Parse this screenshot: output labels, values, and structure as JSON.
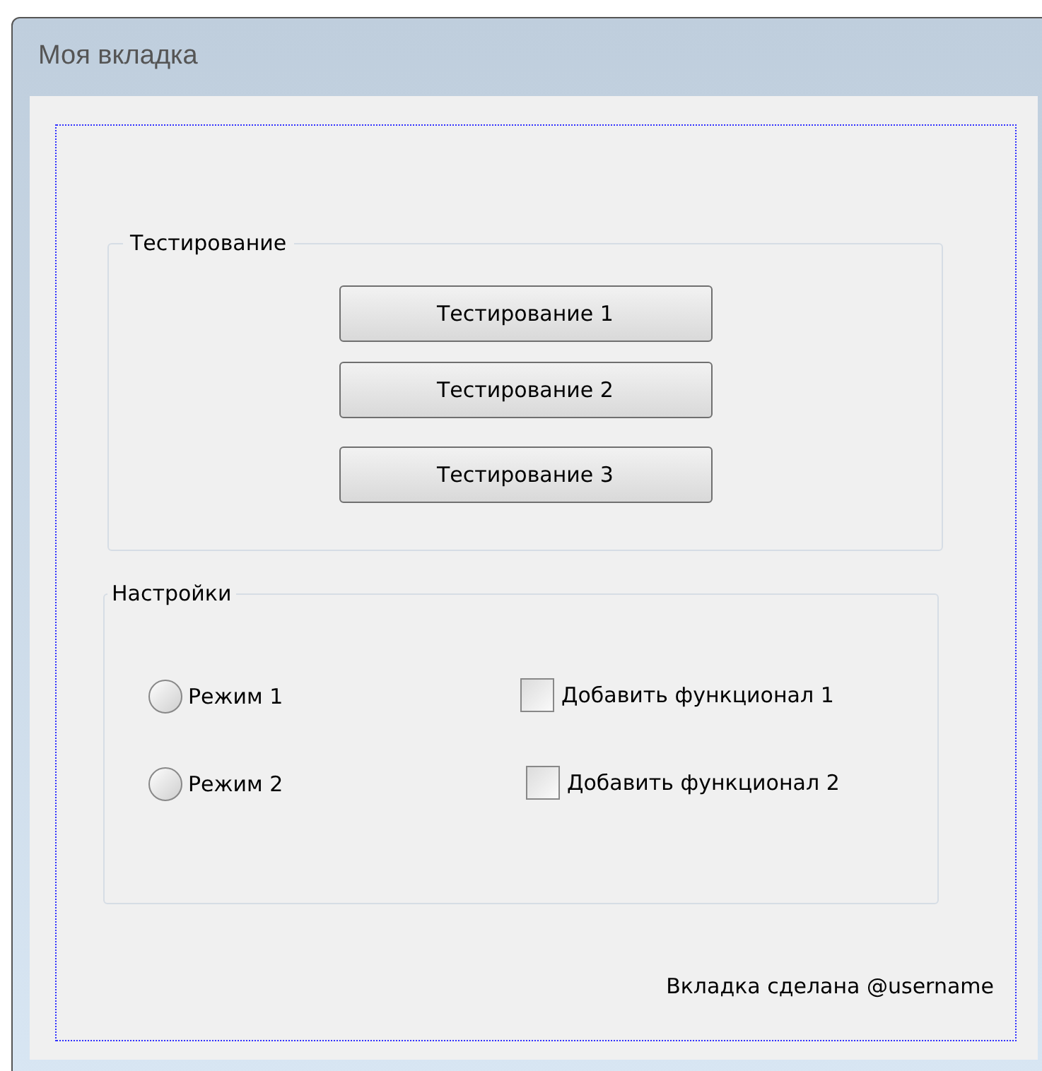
{
  "window": {
    "title": "Моя вкладка"
  },
  "testing_group": {
    "title": "Тестирование",
    "buttons": [
      "Тестирование 1",
      "Тестирование 2",
      "Тестирование 3"
    ]
  },
  "settings_group": {
    "title": "Настройки",
    "radios": [
      {
        "label": "Режим 1",
        "selected": false
      },
      {
        "label": "Режим 2",
        "selected": false
      }
    ],
    "checkboxes": [
      {
        "label": "Добавить функционал 1",
        "checked": false
      },
      {
        "label": "Добавить функционал 2",
        "checked": false
      }
    ]
  },
  "footer": "Вкладка сделана @username"
}
